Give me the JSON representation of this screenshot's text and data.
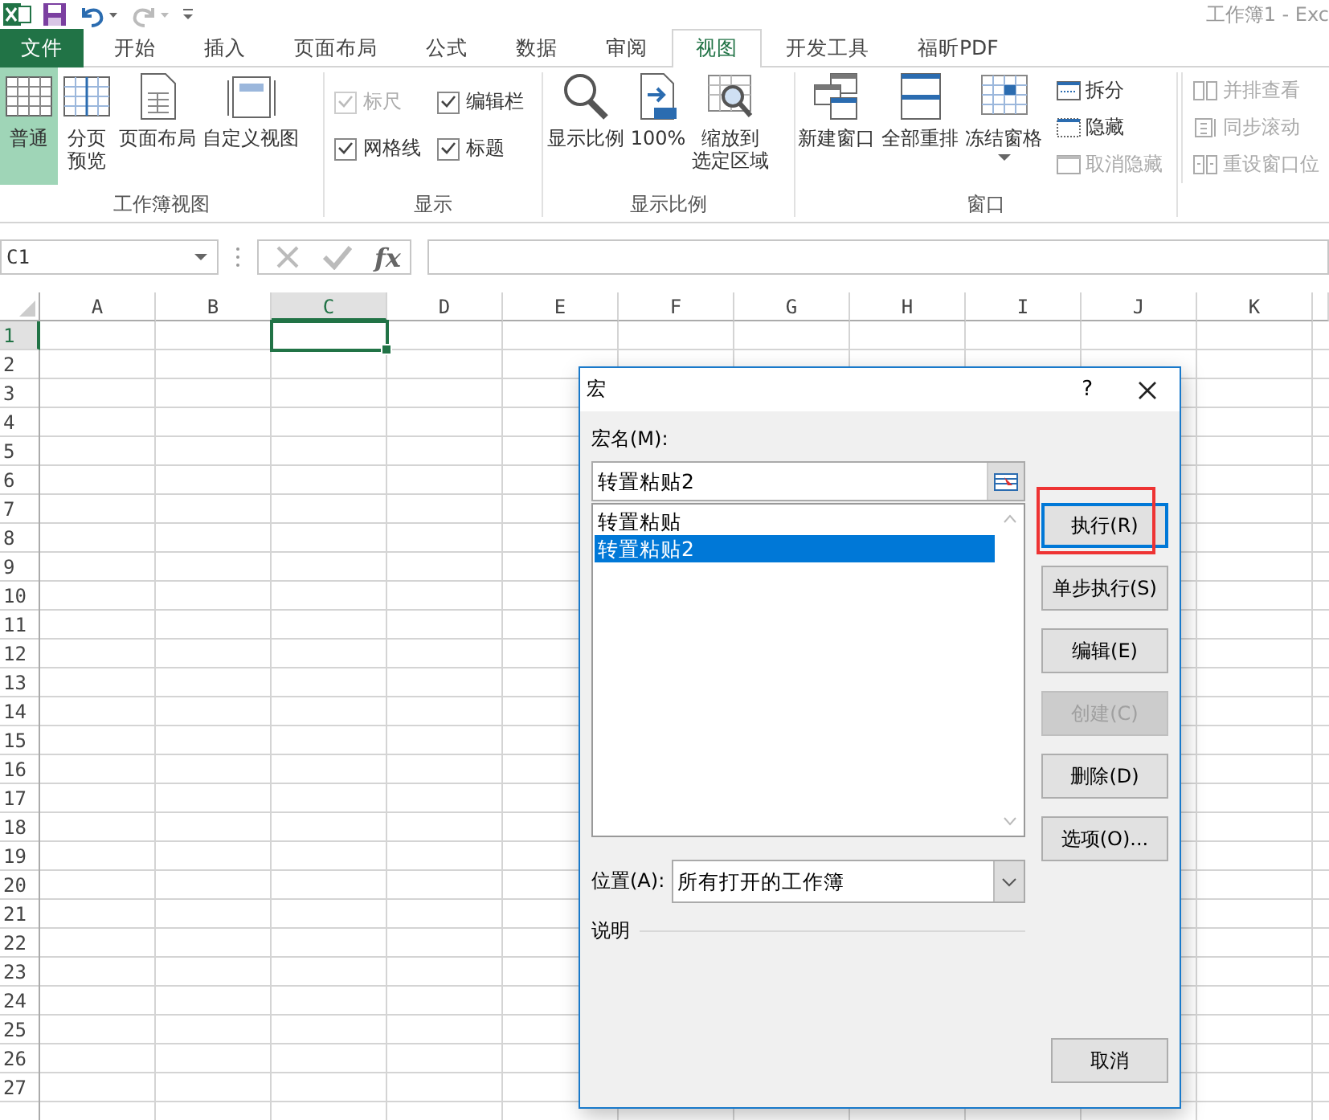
{
  "window": {
    "title": "工作簿1 - Exc"
  },
  "tabs": [
    {
      "label": "文件",
      "kind": "file",
      "selected": false
    },
    {
      "label": "开始",
      "kind": "tab",
      "selected": false
    },
    {
      "label": "插入",
      "kind": "tab",
      "selected": false
    },
    {
      "label": "页面布局",
      "kind": "tab",
      "selected": false
    },
    {
      "label": "公式",
      "kind": "tab",
      "selected": false
    },
    {
      "label": "数据",
      "kind": "tab",
      "selected": false
    },
    {
      "label": "审阅",
      "kind": "tab",
      "selected": false
    },
    {
      "label": "视图",
      "kind": "tab",
      "selected": true
    },
    {
      "label": "开发工具",
      "kind": "tab",
      "selected": false
    },
    {
      "label": "福昕PDF",
      "kind": "tab",
      "selected": false
    }
  ],
  "ribbon": {
    "groups": [
      {
        "label": "工作簿视图",
        "large": [
          {
            "lines": [
              "普通"
            ],
            "selected": true
          },
          {
            "lines": [
              "分页",
              "预览"
            ],
            "selected": false
          },
          {
            "lines": [
              "页面布局"
            ],
            "selected": false
          },
          {
            "lines": [
              "自定义视图"
            ],
            "selected": false
          }
        ]
      },
      {
        "label": "显示",
        "checks": [
          {
            "label": "标尺",
            "checked": true,
            "disabled": true
          },
          {
            "label": "编辑栏",
            "checked": true,
            "disabled": false
          },
          {
            "label": "网格线",
            "checked": true,
            "disabled": false
          },
          {
            "label": "标题",
            "checked": true,
            "disabled": false
          }
        ]
      },
      {
        "label": "显示比例",
        "large": [
          {
            "lines": [
              "显示比例"
            ]
          },
          {
            "lines": [
              "100%"
            ]
          },
          {
            "lines": [
              "缩放到",
              "选定区域"
            ]
          }
        ]
      },
      {
        "label": "窗口",
        "large": [
          {
            "lines": [
              "新建窗口"
            ]
          },
          {
            "lines": [
              "全部重排"
            ]
          },
          {
            "lines": [
              "冻结窗格"
            ],
            "dropdown": true
          }
        ],
        "small": [
          {
            "label": "拆分",
            "disabled": false
          },
          {
            "label": "隐藏",
            "disabled": false
          },
          {
            "label": "取消隐藏",
            "disabled": true
          }
        ]
      },
      {
        "small": [
          {
            "label": "并排查看",
            "disabled": true
          },
          {
            "label": "同步滚动",
            "disabled": true
          },
          {
            "label": "重设窗口位",
            "disabled": true
          }
        ]
      }
    ]
  },
  "formula_bar": {
    "name_box": "C1",
    "function_button": "fx"
  },
  "sheet": {
    "columns": [
      {
        "label": "A",
        "selected": false
      },
      {
        "label": "B",
        "selected": false
      },
      {
        "label": "C",
        "selected": true
      },
      {
        "label": "D",
        "selected": false
      },
      {
        "label": "E",
        "selected": false
      },
      {
        "label": "F",
        "selected": false
      },
      {
        "label": "G",
        "selected": false
      },
      {
        "label": "H",
        "selected": false
      },
      {
        "label": "I",
        "selected": false
      },
      {
        "label": "J",
        "selected": false
      },
      {
        "label": "K",
        "selected": false
      }
    ],
    "rows": [
      {
        "label": "1",
        "selected": true
      },
      {
        "label": "2",
        "selected": false
      },
      {
        "label": "3",
        "selected": false
      },
      {
        "label": "4",
        "selected": false
      },
      {
        "label": "5",
        "selected": false
      },
      {
        "label": "6",
        "selected": false
      },
      {
        "label": "7",
        "selected": false
      },
      {
        "label": "8",
        "selected": false
      },
      {
        "label": "9",
        "selected": false
      },
      {
        "label": "10",
        "selected": false
      },
      {
        "label": "11",
        "selected": false
      },
      {
        "label": "12",
        "selected": false
      },
      {
        "label": "13",
        "selected": false
      },
      {
        "label": "14",
        "selected": false
      },
      {
        "label": "15",
        "selected": false
      },
      {
        "label": "16",
        "selected": false
      },
      {
        "label": "17",
        "selected": false
      },
      {
        "label": "18",
        "selected": false
      },
      {
        "label": "19",
        "selected": false
      },
      {
        "label": "20",
        "selected": false
      },
      {
        "label": "21",
        "selected": false
      },
      {
        "label": "22",
        "selected": false
      },
      {
        "label": "23",
        "selected": false
      },
      {
        "label": "24",
        "selected": false
      },
      {
        "label": "25",
        "selected": false
      },
      {
        "label": "26",
        "selected": false
      },
      {
        "label": "27",
        "selected": false
      }
    ]
  },
  "dialog": {
    "title": "宏",
    "help": "?",
    "name_label": "宏名(M):",
    "name_value": "转置粘贴2",
    "macros": [
      {
        "label": "转置粘贴",
        "selected": false
      },
      {
        "label": "转置粘贴2",
        "selected": true
      }
    ],
    "buttons": [
      {
        "label": "执行(R)",
        "disabled": false,
        "default": true,
        "highlighted": true
      },
      {
        "label": "单步执行(S)",
        "disabled": false,
        "default": false,
        "highlighted": false
      },
      {
        "label": "编辑(E)",
        "disabled": false,
        "default": false,
        "highlighted": false
      },
      {
        "label": "创建(C)",
        "disabled": true,
        "default": false,
        "highlighted": false
      },
      {
        "label": "删除(D)",
        "disabled": false,
        "default": false,
        "highlighted": false
      },
      {
        "label": "选项(O)...",
        "disabled": false,
        "default": false,
        "highlighted": false
      }
    ],
    "location_label": "位置(A):",
    "location_value": "所有打开的工作簿",
    "description_label": "说明",
    "cancel": "取消"
  }
}
